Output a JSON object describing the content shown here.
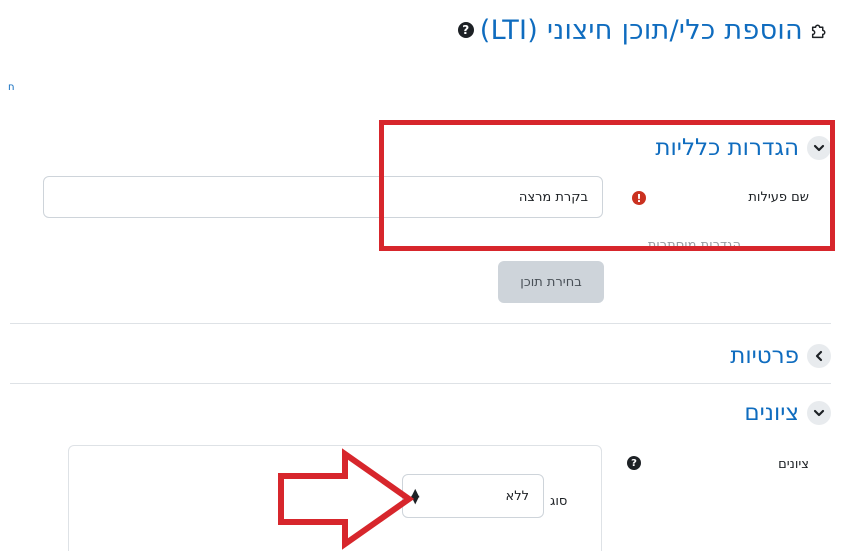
{
  "page": {
    "title": "הוספת כלי/תוכן חיצוני (LTI)",
    "title_icon": "puzzle-icon",
    "help_icon": "question-circle-icon",
    "top_link": "ח"
  },
  "sections": {
    "general": {
      "title": "הגדרות כלליות",
      "expanded": true
    },
    "privacy": {
      "title": "פרטיות",
      "expanded": false
    },
    "grades": {
      "title": "ציונים",
      "expanded": true
    }
  },
  "general_form": {
    "activity_name_label": "שם פעילות",
    "activity_name_value": "בקרת מרצה",
    "hidden_label": "הגדרות מוסתרות",
    "select_content_button": "בחירת תוכן"
  },
  "grades_form": {
    "grade_label": "ציונים",
    "type_label": "סוג",
    "type_value": "ללא"
  },
  "colors": {
    "accent": "#0f6cbf",
    "highlight_red": "#d7262c",
    "error": "#ca3120"
  }
}
